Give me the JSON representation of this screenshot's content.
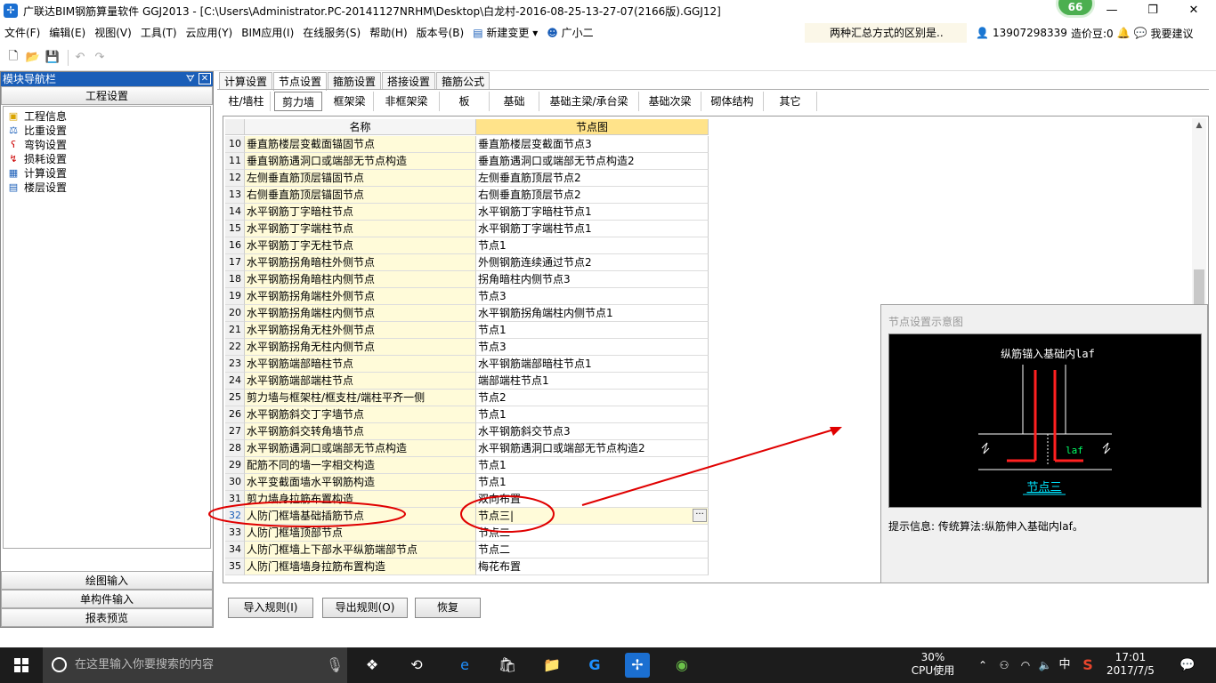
{
  "window": {
    "app_icon": "app-logo-icon",
    "title": "广联达BIM钢筋算量软件 GGJ2013 - [C:\\Users\\Administrator.PC-20141127NRHM\\Desktop\\白龙村-2016-08-25-13-27-07(2166版).GGJ12]",
    "badge": "66",
    "minimize": "—",
    "maximize": "❐",
    "close": "✕"
  },
  "menu": {
    "items": [
      "文件(F)",
      "编辑(E)",
      "视图(V)",
      "工具(T)",
      "云应用(Y)",
      "BIM应用(I)",
      "在线服务(S)",
      "帮助(H)",
      "版本号(B)",
      "新建变更 ▾",
      "广小二"
    ],
    "question": "两种汇总方式的区别是..",
    "phone": "13907298339",
    "cost_beans": "造价豆:0",
    "suggest": "我要建议"
  },
  "nav": {
    "title": "模块导航栏",
    "pin": "ᗊ",
    "close": "✕",
    "section_top": "工程设置",
    "tree": [
      "工程信息",
      "比重设置",
      "弯钩设置",
      "损耗设置",
      "计算设置",
      "楼层设置"
    ],
    "section_bottom": [
      "绘图输入",
      "单构件输入",
      "报表预览"
    ]
  },
  "tabs1": [
    "计算设置",
    "节点设置",
    "箍筋设置",
    "搭接设置",
    "箍筋公式"
  ],
  "tabs2": [
    "柱/墙柱",
    "剪力墙",
    "框架梁",
    "非框架梁",
    "板",
    "基础",
    "基础主梁/承台梁",
    "基础次梁",
    "砌体结构",
    "其它"
  ],
  "grid": {
    "head_name": "名称",
    "head_node": "节点图",
    "rows": [
      {
        "n": "10",
        "name": "垂直筋楼层变截面锚固节点",
        "node": "垂直筋楼层变截面节点3"
      },
      {
        "n": "11",
        "name": "垂直钢筋遇洞口或端部无节点构造",
        "node": "垂直筋遇洞口或端部无节点构造2"
      },
      {
        "n": "12",
        "name": "左侧垂直筋顶层锚固节点",
        "node": "左侧垂直筋顶层节点2"
      },
      {
        "n": "13",
        "name": "右侧垂直筋顶层锚固节点",
        "node": "右侧垂直筋顶层节点2"
      },
      {
        "n": "14",
        "name": "水平钢筋丁字暗柱节点",
        "node": "水平钢筋丁字暗柱节点1"
      },
      {
        "n": "15",
        "name": "水平钢筋丁字端柱节点",
        "node": "水平钢筋丁字端柱节点1"
      },
      {
        "n": "16",
        "name": "水平钢筋丁字无柱节点",
        "node": "节点1"
      },
      {
        "n": "17",
        "name": "水平钢筋拐角暗柱外侧节点",
        "node": "外侧钢筋连续通过节点2"
      },
      {
        "n": "18",
        "name": "水平钢筋拐角暗柱内侧节点",
        "node": "拐角暗柱内侧节点3"
      },
      {
        "n": "19",
        "name": "水平钢筋拐角端柱外侧节点",
        "node": "节点3"
      },
      {
        "n": "20",
        "name": "水平钢筋拐角端柱内侧节点",
        "node": "水平钢筋拐角端柱内侧节点1"
      },
      {
        "n": "21",
        "name": "水平钢筋拐角无柱外侧节点",
        "node": "节点1"
      },
      {
        "n": "22",
        "name": "水平钢筋拐角无柱内侧节点",
        "node": "节点3"
      },
      {
        "n": "23",
        "name": "水平钢筋端部暗柱节点",
        "node": "水平钢筋端部暗柱节点1"
      },
      {
        "n": "24",
        "name": "水平钢筋端部端柱节点",
        "node": "端部端柱节点1"
      },
      {
        "n": "25",
        "name": "剪力墙与框架柱/框支柱/端柱平齐一侧",
        "node": "节点2"
      },
      {
        "n": "26",
        "name": "水平钢筋斜交丁字墙节点",
        "node": "节点1"
      },
      {
        "n": "27",
        "name": "水平钢筋斜交转角墙节点",
        "node": "水平钢筋斜交节点3"
      },
      {
        "n": "28",
        "name": "水平钢筋遇洞口或端部无节点构造",
        "node": "水平钢筋遇洞口或端部无节点构造2"
      },
      {
        "n": "29",
        "name": "配筋不同的墙一字相交构造",
        "node": "节点1"
      },
      {
        "n": "30",
        "name": "水平变截面墙水平钢筋构造",
        "node": "节点1"
      },
      {
        "n": "31",
        "name": "剪力墙身拉筋布置构造",
        "node": "双向布置"
      },
      {
        "n": "32",
        "name": "人防门框墙基础插筋节点",
        "node": "节点三|"
      },
      {
        "n": "33",
        "name": "人防门框墙顶部节点",
        "node": "节点二"
      },
      {
        "n": "34",
        "name": "人防门框墙上下部水平纵筋端部节点",
        "node": "节点二"
      },
      {
        "n": "35",
        "name": "人防门框墙墙身拉筋布置构造",
        "node": "梅花布置"
      }
    ],
    "ellipsis": "···"
  },
  "preview": {
    "title": "节点设置示意图",
    "drawing_label": "纵筋锚入基础内laf",
    "laf": "laf",
    "caption": "节点三",
    "hint": "提示信息:  传统算法:纵筋伸入基础内laf。"
  },
  "buttons": {
    "import": "导入规则(I)",
    "export": "导出规则(O)",
    "restore": "恢复"
  },
  "taskbar": {
    "search_placeholder": "在这里输入你要搜索的内容",
    "cpu_pct": "30%",
    "cpu_label": "CPU使用",
    "ime": "中",
    "time": "17:01",
    "date": "2017/7/5"
  },
  "colors": {
    "accent": "#1a5eb8",
    "annotation": "#e00000",
    "name_cell": "#fffbd9",
    "rebar": "#ff2020",
    "caption": "#00e5ff"
  }
}
